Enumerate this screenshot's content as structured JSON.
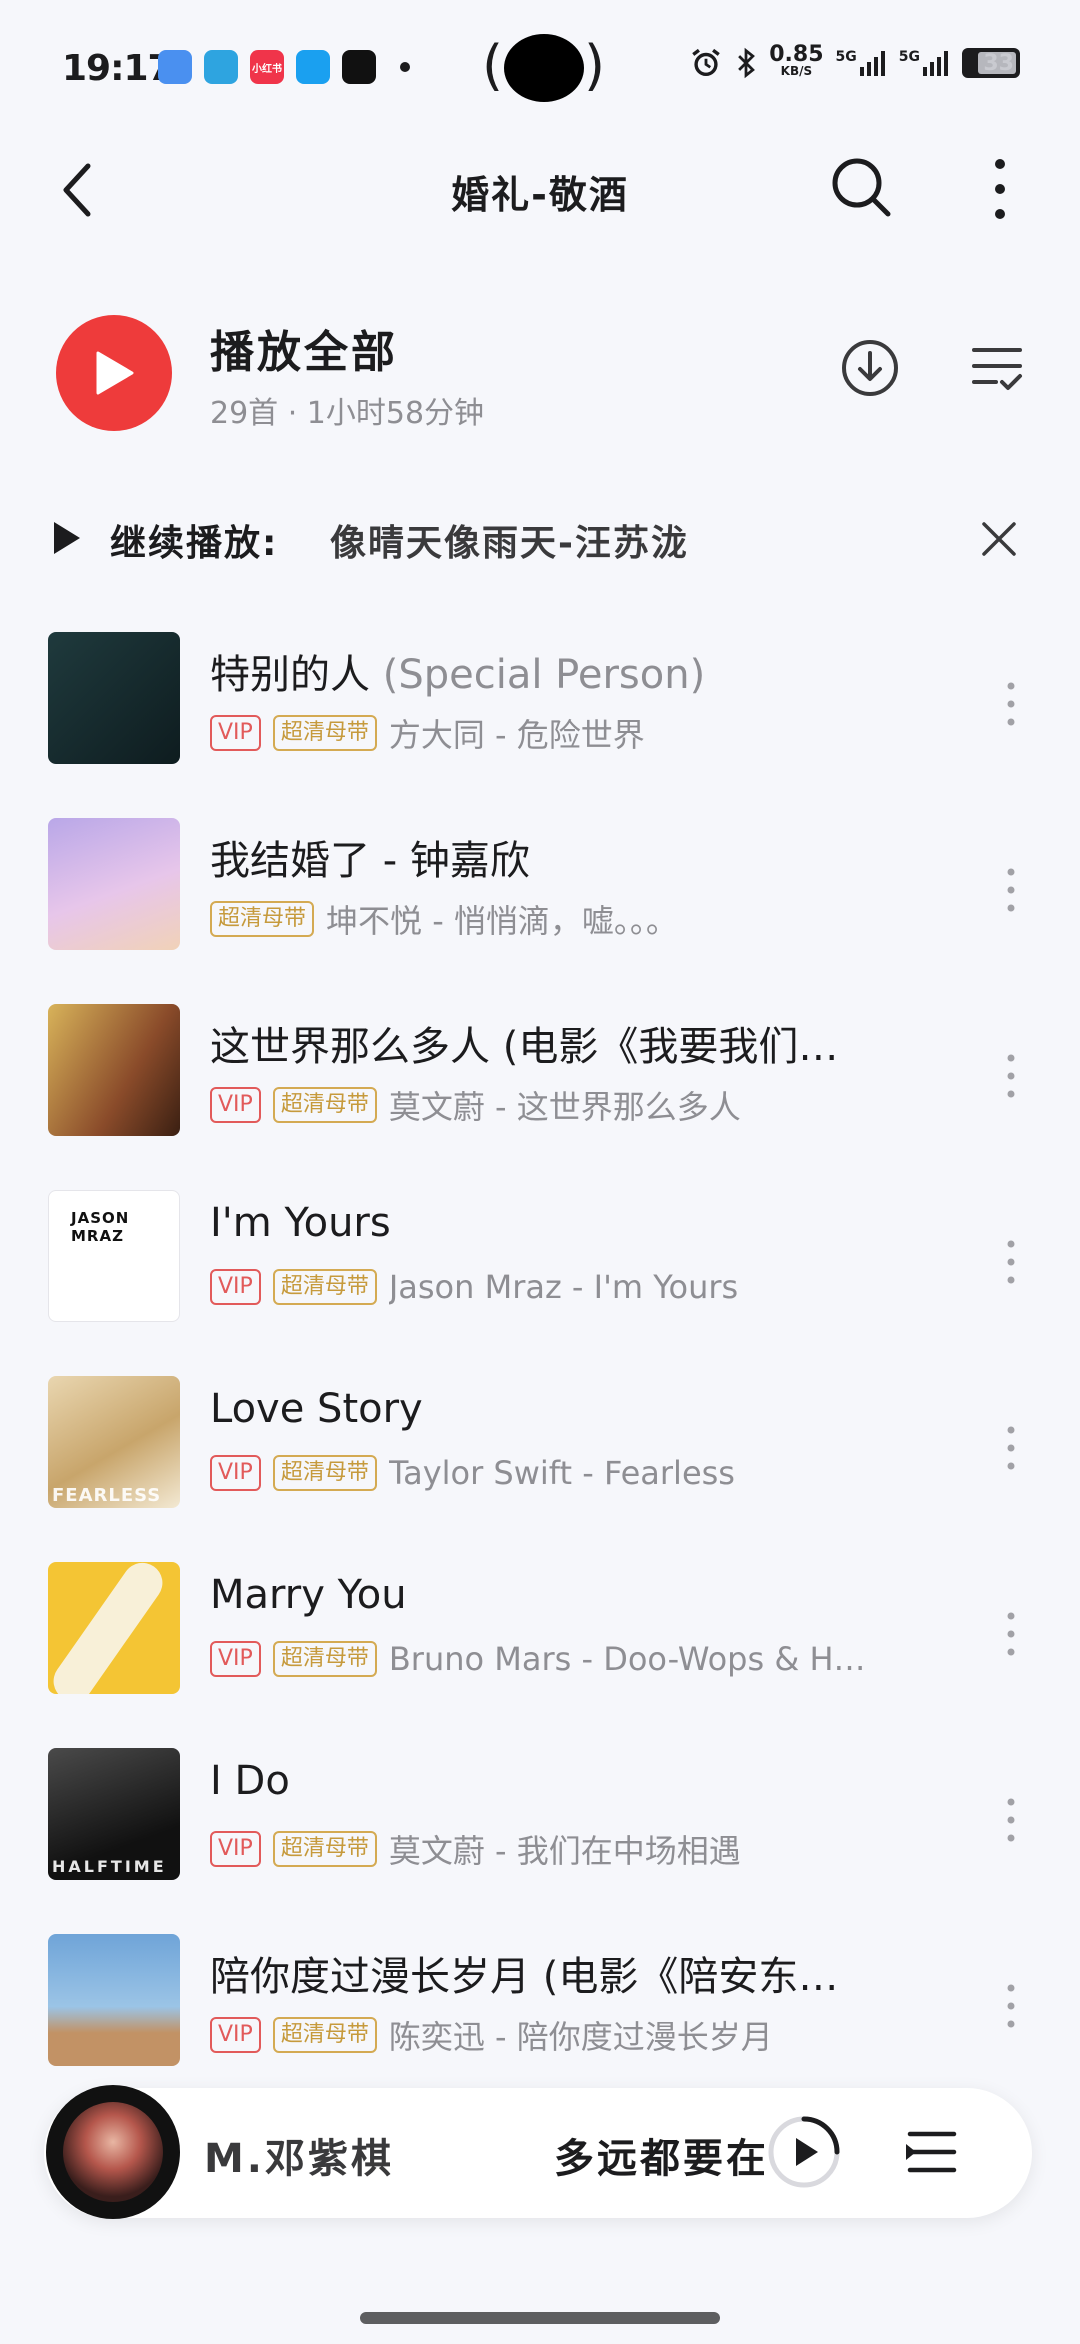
{
  "status_bar": {
    "time": "19:17",
    "net_speed_value": "0.85",
    "net_speed_unit": "KB/S",
    "signal_1": "5G",
    "signal_2": "5G",
    "battery": "33",
    "apps": [
      {
        "name": "gallery-app-icon",
        "color": "#4a90f0",
        "label": ""
      },
      {
        "name": "telegram-app-icon",
        "color": "#2ea4e0",
        "label": ""
      },
      {
        "name": "xiaohongshu-app-icon",
        "color": "#f0344a",
        "label": "小红书"
      },
      {
        "name": "qq-app-icon",
        "color": "#1aa0f0",
        "label": ""
      },
      {
        "name": "tiktok-app-icon",
        "color": "#111111",
        "label": ""
      }
    ]
  },
  "nav": {
    "title": "婚礼-敬酒"
  },
  "play_all": {
    "title": "播放全部",
    "meta": "29首 · 1小时58分钟"
  },
  "continue": {
    "label": "继续播放:",
    "song": "像晴天像雨天-汪苏泷"
  },
  "songs": [
    {
      "title": "特别的人",
      "subtitle": " (Special Person)",
      "vip": "VIP",
      "hq": "超清母带",
      "artist": "方大同 - 危险世界",
      "cover_bg": "linear-gradient(135deg,#1f3a3d,#0e1c1f)",
      "cover_text": "",
      "has_vip": true
    },
    {
      "title": "我结婚了 - 钟嘉欣",
      "subtitle": "",
      "vip": "",
      "hq": "超清母带",
      "artist": "坤不悦 - 悄悄滴，嘘。。。",
      "cover_bg": "linear-gradient(160deg,#b9a7e8,#e7c6ea 55%,#f1d2b8)",
      "cover_text": "",
      "has_vip": false
    },
    {
      "title": "这世界那么多人 (电影《我要我们…",
      "subtitle": "",
      "vip": "VIP",
      "hq": "超清母带",
      "artist": "莫文蔚 - 这世界那么多人",
      "cover_bg": "linear-gradient(120deg,#d8b35a,#8a4b2a 60%,#3a1f12)",
      "cover_text": "",
      "has_vip": true
    },
    {
      "title": "I'm Yours",
      "subtitle": "",
      "vip": "VIP",
      "hq": "超清母带",
      "artist": "Jason Mraz - I'm Yours",
      "cover_bg": "#ffffff",
      "cover_text": "JASON MRAZ",
      "has_vip": true
    },
    {
      "title": "Love Story",
      "subtitle": "",
      "vip": "VIP",
      "hq": "超清母带",
      "artist": "Taylor Swift - Fearless",
      "cover_bg": "linear-gradient(150deg,#e9d6b0,#c8a56b 55%,#f3e9d3)",
      "cover_text": "FEARLESS",
      "has_vip": true
    },
    {
      "title": "Marry You",
      "subtitle": "",
      "vip": "VIP",
      "hq": "超清母带",
      "artist": "Bruno Mars - Doo-Wops & H…",
      "cover_bg": "#f4c534",
      "cover_text": "",
      "has_vip": true
    },
    {
      "title": "I Do",
      "subtitle": "",
      "vip": "VIP",
      "hq": "超清母带",
      "artist": "莫文蔚 - 我们在中场相遇",
      "cover_bg": "linear-gradient(160deg,#4a4a4a,#111 70%)",
      "cover_text": "HALFTIME",
      "has_vip": true
    },
    {
      "title": "陪你度过漫长岁月 (电影《陪安东…",
      "subtitle": "",
      "vip": "VIP",
      "hq": "超清母带",
      "artist": "陈奕迅 - 陪你度过漫长岁月",
      "cover_bg": "linear-gradient(180deg,#6fa4d8,#9bc4e6 55%,#c29265 75%)",
      "cover_text": "",
      "has_vip": true
    }
  ],
  "mini_player": {
    "left_text": "M.邓紫棋",
    "right_text": "多远都要在"
  },
  "colors": {
    "accent_red": "#ee3b3b",
    "vip_red": "#e25a5a",
    "hq_gold": "#c69a3c"
  }
}
